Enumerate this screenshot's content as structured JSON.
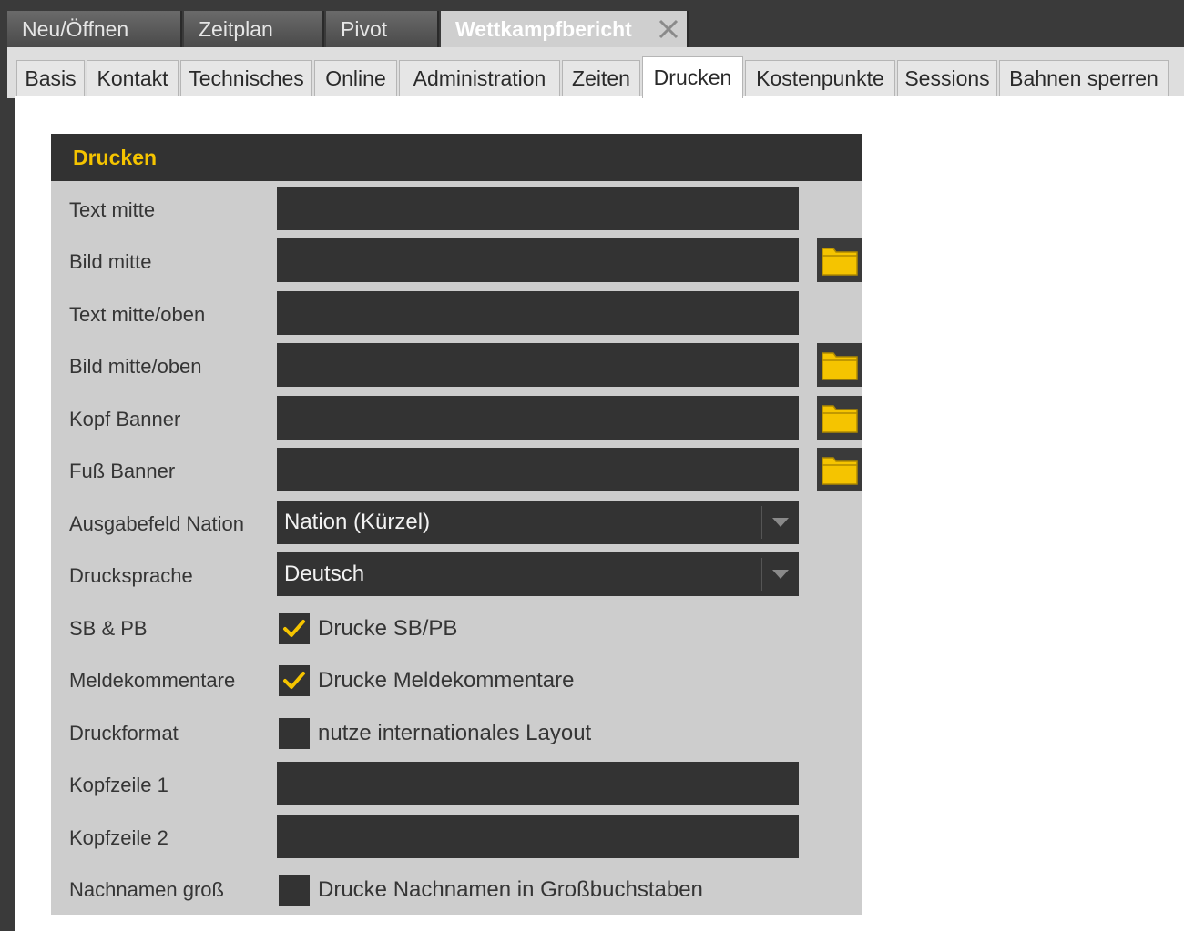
{
  "main_tabs": [
    "Neu/Öffnen",
    "Zeitplan",
    "Pivot",
    "Wettkampfbericht"
  ],
  "sub_tabs": [
    "Basis",
    "Kontakt",
    "Technisches",
    "Online",
    "Administration",
    "Zeiten",
    "Drucken",
    "Kostenpunkte",
    "Sessions",
    "Bahnen sperren"
  ],
  "active_sub_tab": "Drucken",
  "panel": {
    "title": "Drucken",
    "rows": {
      "text_mitte": {
        "label": "Text mitte",
        "value": ""
      },
      "bild_mitte": {
        "label": "Bild mitte",
        "value": ""
      },
      "text_mitte_oben": {
        "label": "Text mitte/oben",
        "value": ""
      },
      "bild_mitte_oben": {
        "label": "Bild mitte/oben",
        "value": ""
      },
      "kopf_banner": {
        "label": "Kopf Banner",
        "value": ""
      },
      "fuss_banner": {
        "label": "Fuß Banner",
        "value": ""
      },
      "ausgabefeld_nation": {
        "label": "Ausgabefeld Nation",
        "value": "Nation (Kürzel)"
      },
      "drucksprache": {
        "label": "Drucksprache",
        "value": "Deutsch"
      },
      "sb_pb": {
        "label": "SB & PB",
        "checkbox_label": "Drucke SB/PB",
        "checked": true
      },
      "meldekommentare": {
        "label": "Meldekommentare",
        "checkbox_label": "Drucke Meldekommentare",
        "checked": true
      },
      "druckformat": {
        "label": "Druckformat",
        "checkbox_label": "nutze internationales Layout",
        "checked": false
      },
      "kopfzeile_1": {
        "label": "Kopfzeile 1",
        "value": ""
      },
      "kopfzeile_2": {
        "label": "Kopfzeile 2",
        "value": ""
      },
      "nachnamen_gross": {
        "label": "Nachnamen groß",
        "checkbox_label": "Drucke Nachnamen in Großbuchstaben",
        "checked": false
      }
    }
  },
  "colors": {
    "accent": "#f5c400",
    "dark_field": "#333333",
    "panel_bg": "#cdcdcd",
    "header_bg": "#323232"
  },
  "icons": {
    "folder": "folder-icon",
    "check": "check-icon",
    "dropdown": "chevron-down-icon",
    "close": "close-icon"
  }
}
